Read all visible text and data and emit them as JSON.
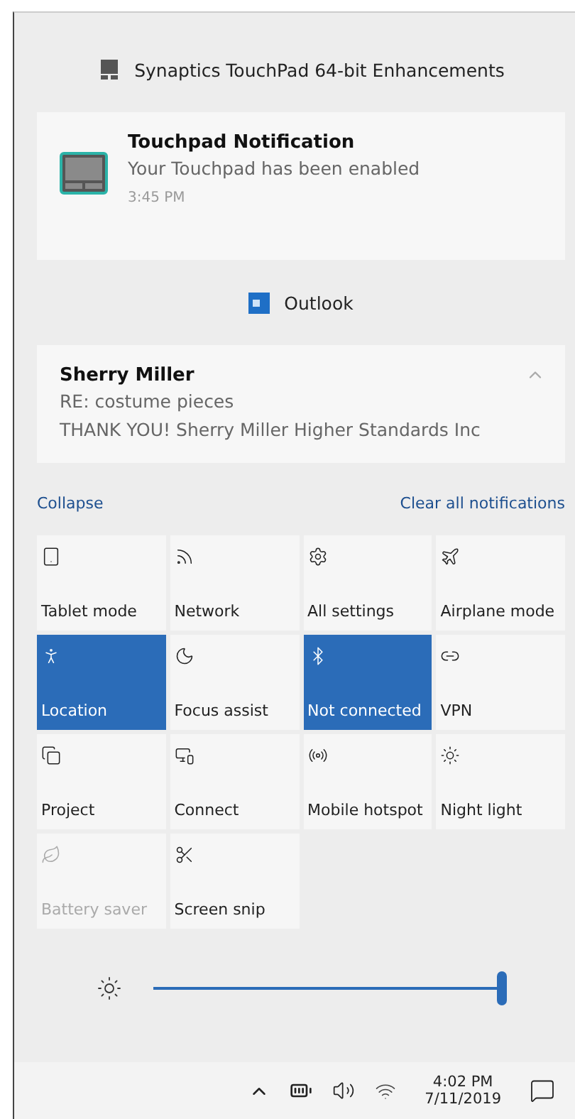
{
  "notification_groups": [
    {
      "app": "Synaptics TouchPad 64-bit Enhancements",
      "kind": "touchpad",
      "notifications": [
        {
          "title": "Touchpad Notification",
          "body": "Your Touchpad has been enabled",
          "time": "3:45 PM",
          "kind": "icon"
        }
      ]
    },
    {
      "app": "Outlook",
      "kind": "outlook",
      "notifications": [
        {
          "title": "Sherry Miller",
          "body": "RE: costume pieces",
          "preview": "THANK YOU!  Sherry Miller  Higher Standards Inc",
          "kind": "expandable"
        }
      ]
    }
  ],
  "actions": {
    "collapse": "Collapse",
    "clear_all": "Clear all notifications"
  },
  "quick_actions": [
    {
      "label": "Tablet mode",
      "on": false,
      "disabled": false
    },
    {
      "label": "Network",
      "on": false,
      "disabled": false
    },
    {
      "label": "All settings",
      "on": false,
      "disabled": false
    },
    {
      "label": "Airplane mode",
      "on": false,
      "disabled": false
    },
    {
      "label": "Location",
      "on": true,
      "disabled": false
    },
    {
      "label": "Focus assist",
      "on": false,
      "disabled": false
    },
    {
      "label": "Not connected",
      "on": true,
      "disabled": false
    },
    {
      "label": "VPN",
      "on": false,
      "disabled": false
    },
    {
      "label": "Project",
      "on": false,
      "disabled": false
    },
    {
      "label": "Connect",
      "on": false,
      "disabled": false
    },
    {
      "label": "Mobile hotspot",
      "on": false,
      "disabled": false
    },
    {
      "label": "Night light",
      "on": false,
      "disabled": false
    },
    {
      "label": "Battery saver",
      "on": false,
      "disabled": true
    },
    {
      "label": "Screen snip",
      "on": false,
      "disabled": false
    }
  ],
  "brightness": {
    "level": 1
  },
  "taskbar": {
    "time": "4:02 PM",
    "date": "7/11/2019"
  }
}
